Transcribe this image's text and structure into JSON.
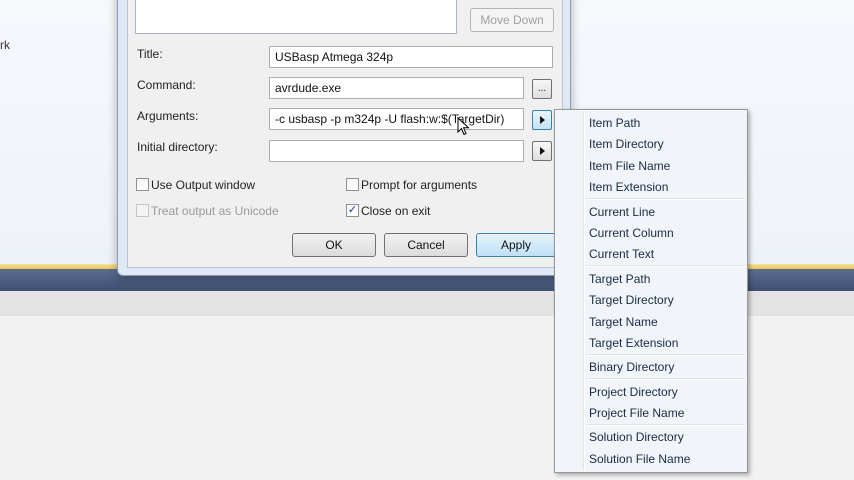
{
  "background": {
    "edge_text": "rk"
  },
  "dialog": {
    "move_down_label": "Move Down",
    "title_label": "Title:",
    "title_value": "USBasp Atmega 324p",
    "command_label": "Command:",
    "command_value": "avrdude.exe",
    "browse_label": "...",
    "arguments_label": "Arguments:",
    "arguments_value": "-c usbasp -p m324p -U flash:w:$(TargetDir)",
    "initial_directory_label": "Initial directory:",
    "initial_directory_value": "",
    "use_output_window_label": "Use Output window",
    "use_output_window_checked": false,
    "treat_output_unicode_label": "Treat output as Unicode",
    "treat_output_unicode_checked": false,
    "prompt_for_arguments_label": "Prompt for arguments",
    "prompt_for_arguments_checked": false,
    "close_on_exit_label": "Close on exit",
    "close_on_exit_checked": true,
    "check_mark": "✓",
    "ok_label": "OK",
    "cancel_label": "Cancel",
    "apply_label": "Apply"
  },
  "menu": {
    "items": [
      "Item Path",
      "Item Directory",
      "Item File Name",
      "Item Extension",
      "Current Line",
      "Current Column",
      "Current Text",
      "Target Path",
      "Target Directory",
      "Target Name",
      "Target Extension",
      "Binary Directory",
      "Project Directory",
      "Project File Name",
      "Solution Directory",
      "Solution File Name"
    ]
  }
}
